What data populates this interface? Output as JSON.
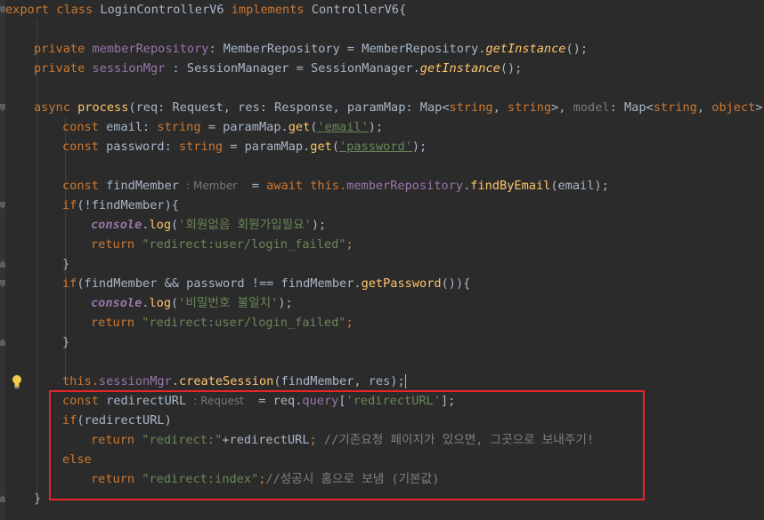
{
  "editor": {
    "language": "typescript",
    "lines": {
      "l1": {
        "kw": "export class ",
        "name": "LoginControllerV6",
        "kw2": " implements ",
        "iface": "ControllerV6{"
      },
      "l2": {
        "kw": "private ",
        "field": "memberRepository",
        "mid": ": MemberRepository = MemberRepository.",
        "method": "getInstance",
        "end": "();"
      },
      "l3": {
        "kw": "private ",
        "field": "sessionMgr",
        "mid": " : SessionManager = SessionManager.",
        "method": "getInstance",
        "end": "();"
      },
      "l4": {
        "kw": "async ",
        "method": "process",
        "p1": "(req: Request, res: Response, paramMap: Map<",
        "t1": "string",
        "c1": ", ",
        "t2": "string",
        "p2": ">, ",
        "model": "model",
        "p3": ": Map<",
        "t3": "string",
        "c2": ", ",
        "t4": "object",
        "p4": ">) :"
      },
      "l5": {
        "kw": "const ",
        "a": "email: ",
        "t": "string",
        "b": " = paramMap.",
        "method": "get",
        "c": "(",
        "s": "'email'",
        "d": ");"
      },
      "l6": {
        "kw": "const ",
        "a": "password: ",
        "t": "string",
        "b": " = paramMap.",
        "method": "get",
        "c": "(",
        "s": "'password'",
        "d": ");"
      },
      "l7": {
        "kw": "const ",
        "a": "findMember",
        "hint": ": Member",
        "b": " = ",
        "await": "await ",
        "this": "this.",
        "field": "memberRepository",
        "dot": ".",
        "method": "findByEmail",
        "end": "(email);"
      },
      "l8": {
        "kw": "if",
        "rest": "(!findMember){"
      },
      "l9": {
        "cons": "console",
        "dot": ".",
        "method": "log",
        "a": "(",
        "s": "'회원없음 회원가입필요'",
        "b": ");"
      },
      "l10": {
        "kw": "return ",
        "s": "\"redirect:user/login_failed\"",
        "end": ";"
      },
      "l11": {
        "text": "}"
      },
      "l12": {
        "kw": "if",
        "a": "(findMember && password !== findMember.",
        "method": "getPassword",
        "b": "()){"
      },
      "l13": {
        "cons": "console",
        "dot": ".",
        "method": "log",
        "a": "(",
        "s": "'비밀번호 불일치'",
        "b": ");"
      },
      "l14": {
        "kw": "return ",
        "s": "\"redirect:user/login_failed\"",
        "end": ";"
      },
      "l15": {
        "text": "}"
      },
      "l16": {
        "this": "this.",
        "field": "sessionMgr",
        "dot": ".",
        "method": "createSession",
        "end": "(findMember, res);"
      },
      "l17": {
        "kw": "const ",
        "a": "redirectURL",
        "hint": ": Request",
        "b": " = req.",
        "field": "query",
        "c": "[",
        "s": "'redirectURL'",
        "d": "];"
      },
      "l18": {
        "kw": "if",
        "rest": "(redirectURL)"
      },
      "l19": {
        "kw": "return ",
        "s": "\"redirect:\"",
        "a": "+redirectURL",
        "semi": "; ",
        "comment": "//기존요청 페이지가 있으면, 그곳으로 보내주기!"
      },
      "l20": {
        "kw": "else"
      },
      "l21": {
        "kw": "return ",
        "s": "\"redirect:index\"",
        "semi": ";",
        "comment": "//성공시 홈으로 보냄 (기본값)"
      },
      "l22": {
        "text": "}"
      }
    },
    "colors": {
      "background": "#2b2b2b",
      "keyword": "#cc7832",
      "field": "#9876aa",
      "method": "#ffc66d",
      "string": "#6a8759",
      "text": "#a9b7c6",
      "highlight_box": "#e5252a"
    }
  }
}
